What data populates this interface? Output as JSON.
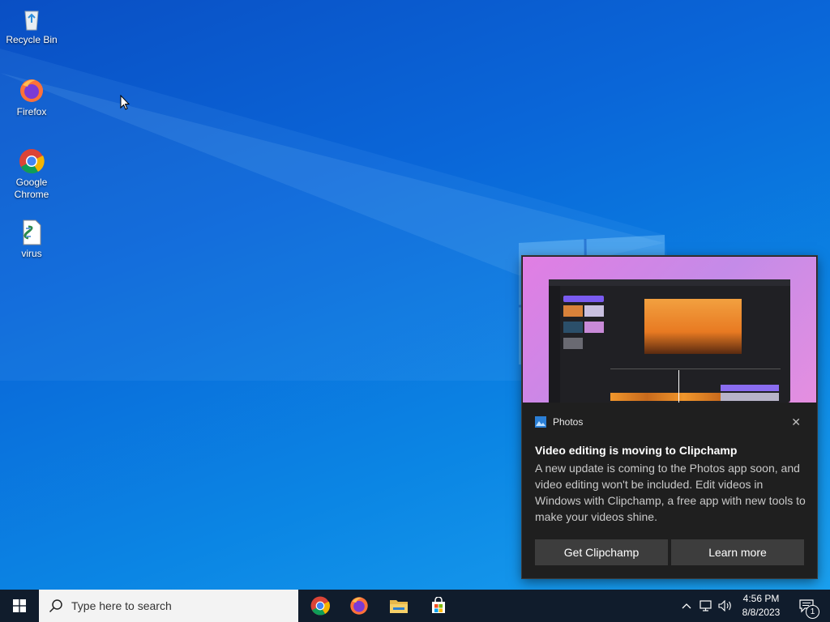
{
  "desktop": {
    "icons": [
      {
        "label": "Recycle Bin",
        "icon": "recycle-bin-icon"
      },
      {
        "label": "Firefox",
        "icon": "firefox-icon"
      },
      {
        "label": "Google Chrome",
        "icon": "chrome-icon"
      },
      {
        "label": "virus",
        "icon": "script-file-icon"
      }
    ]
  },
  "toast": {
    "app_name": "Photos",
    "app_icon": "photos-icon",
    "title": "Video editing is moving to Clipchamp",
    "body": "A new update is coming to the Photos app soon, and video editing won't be included. Edit videos in Windows with Clipchamp, a free app with new tools to make your videos shine.",
    "buttons": [
      "Get Clipchamp",
      "Learn more"
    ],
    "close_icon": "close-icon"
  },
  "taskbar": {
    "start_icon": "windows-start-icon",
    "search_placeholder": "Type here to search",
    "pinned": [
      "chrome-icon",
      "firefox-icon",
      "file-explorer-icon",
      "microsoft-store-icon"
    ],
    "tray": {
      "time": "4:56 PM",
      "date": "8/8/2023",
      "notification_count": "1"
    }
  },
  "colors": {
    "desktop_accent": "#0a66d8",
    "taskbar": "#101c2c",
    "toast_bg": "#1f1f1f",
    "toast_button": "#3d3d3d"
  }
}
